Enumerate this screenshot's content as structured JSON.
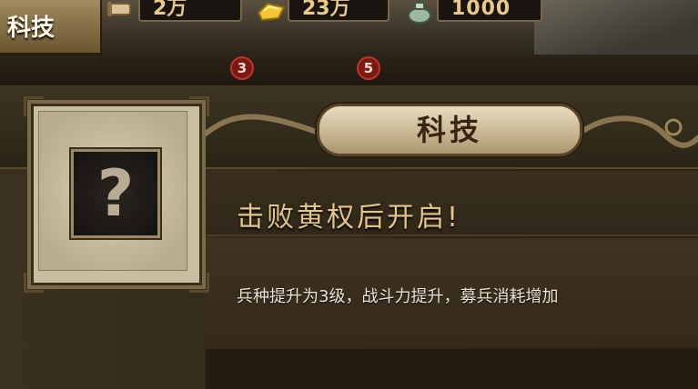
{
  "topbar": {
    "tab_label": "科技",
    "resources": [
      {
        "icon": "scroll-icon",
        "value": "2万"
      },
      {
        "icon": "gold-ingot-icon",
        "value": "23万"
      },
      {
        "icon": "silver-bag-icon",
        "value": "1000"
      }
    ],
    "badges": [
      "3",
      "5"
    ]
  },
  "panel": {
    "title": "科技",
    "unlock_text": "击败黄权后开启!",
    "description": "兵种提升为3级，战斗力提升，募兵消耗增加",
    "slot_icon": "question-mark-icon",
    "slot_glyph": "?"
  },
  "colors": {
    "accent_gold": "#e2c58a",
    "plaque": "#d8caa6",
    "badge_red": "#7a1a12"
  }
}
